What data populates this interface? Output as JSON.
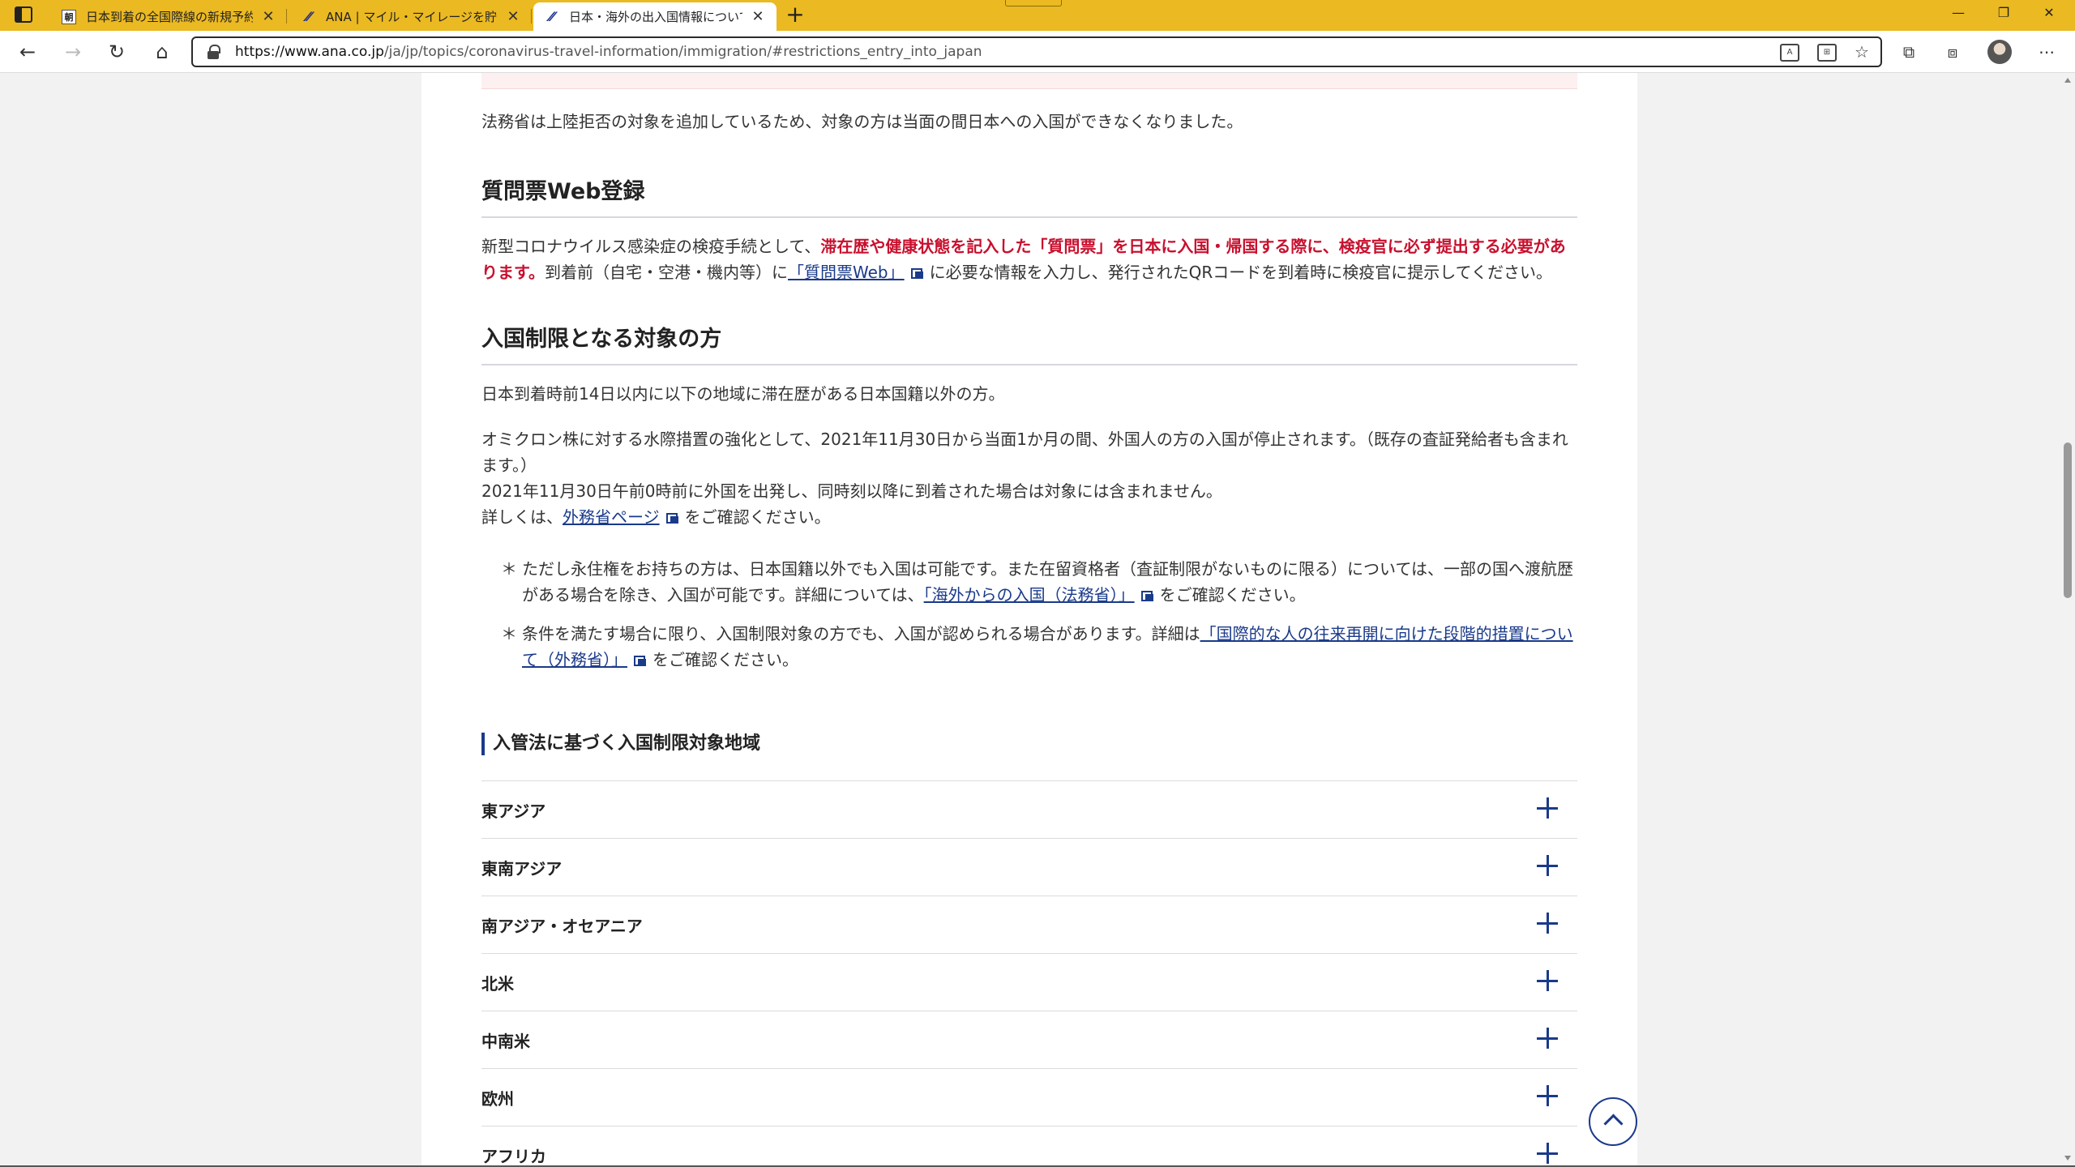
{
  "tabs": [
    {
      "title": "日本到着の全国際線の新規予約停止 国交省が要請 (写真=共同) - 日本経済新聞",
      "favicon": "news-icon"
    },
    {
      "title": "ANA | マイル・マイレージを貯めて多彩な特典と交換",
      "favicon": "ana-logo-icon"
    },
    {
      "title": "日本・海外の出入国情報について | ANA",
      "favicon": "ana-logo-icon"
    }
  ],
  "favicon_text": {
    "news": "朝"
  },
  "address_bar": {
    "url_domain": "https://www.ana.co.jp",
    "url_path": "/ja/jp/topics/coronavirus-travel-information/immigration/#restrictions_entry_into_japan"
  },
  "page": {
    "intro": "法務省は上陸拒否の対象を追加しているため、対象の方は当面の間日本への入国ができなくなりました。",
    "section1": {
      "heading": "質問票Web登録",
      "text_a": "新型コロナウイルス感染症の検疫手続として、",
      "text_red": "滞在歴や健康状態を記入した「質問票」を日本に入国・帰国する際に、検疫官に必ず提出する必要があります。",
      "text_b": "到着前（自宅・空港・機内等）に",
      "link": "「質問票Web」",
      "text_c": "に必要な情報を入力し、発行されたQRコードを到着時に検疫官に提示してください。"
    },
    "section2": {
      "heading": "入国制限となる対象の方",
      "p1": "日本到着時前14日以内に以下の地域に滞在歴がある日本国籍以外の方。",
      "p2": "オミクロン株に対する水際措置の強化として、2021年11月30日から当面1か月の間、外国人の方の入国が停止されます。（既存の査証発給者も含まれます。）",
      "p3": "2021年11月30日午前0時前に外国を出発し、同時刻以降に到着された場合は対象には含まれません。",
      "p4_a": "詳しくは、",
      "p4_link": "外務省ページ",
      "p4_b": "をご確認ください。",
      "note_mark": "＊",
      "note1_a": "ただし永住権をお持ちの方は、日本国籍以外でも入国は可能です。また在留資格者（査証制限がないものに限る）については、一部の国へ渡航歴がある場合を除き、入国が可能です。詳細については、",
      "note1_link": "「海外からの入国（法務省）」",
      "note1_b": "をご確認ください。",
      "note2_a": "条件を満たす場合に限り、入国制限対象の方でも、入国が認められる場合があります。詳細は",
      "note2_link": "「国際的な人の往来再開に向けた段階的措置について（外務省）」",
      "note2_b": "をご確認ください。"
    },
    "subheading": "入管法に基づく入国制限対象地域",
    "regions": [
      "東アジア",
      "東南アジア",
      "南アジア・オセアニア",
      "北米",
      "中南米",
      "欧州",
      "アフリカ"
    ]
  }
}
